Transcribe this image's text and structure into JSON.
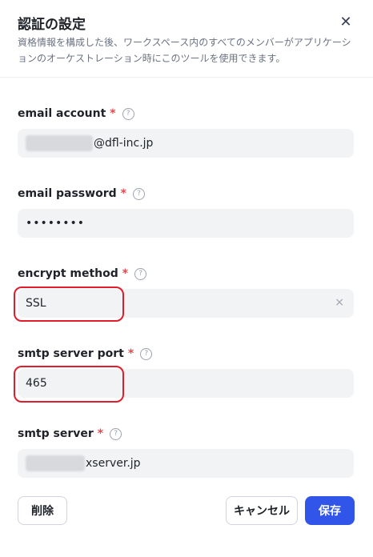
{
  "dialog": {
    "title": "認証の設定",
    "description": "資格情報を構成した後、ワークスペース内のすべてのメンバーがアプリケーションのオーケストレーション時にこのツールを使用できます。",
    "close_icon": "close-icon"
  },
  "fields": {
    "email_account": {
      "label": "email account",
      "required": "*",
      "help": "?",
      "value_suffix": "@dfl-inc.jp"
    },
    "email_password": {
      "label": "email password",
      "required": "*",
      "help": "?",
      "value": "••••••••"
    },
    "encrypt_method": {
      "label": "encrypt method",
      "required": "*",
      "help": "?",
      "value": "SSL",
      "clear": "×"
    },
    "smtp_server_port": {
      "label": "smtp server port",
      "required": "*",
      "help": "?",
      "value": "465"
    },
    "smtp_server": {
      "label": "smtp server",
      "required": "*",
      "help": "?",
      "value_suffix": "xserver.jp"
    }
  },
  "footer": {
    "delete_label": "削除",
    "cancel_label": "キャンセル",
    "save_label": "保存"
  },
  "colors": {
    "accent": "#3155e8",
    "required": "#e5484d",
    "highlight": "#e11d2c"
  }
}
